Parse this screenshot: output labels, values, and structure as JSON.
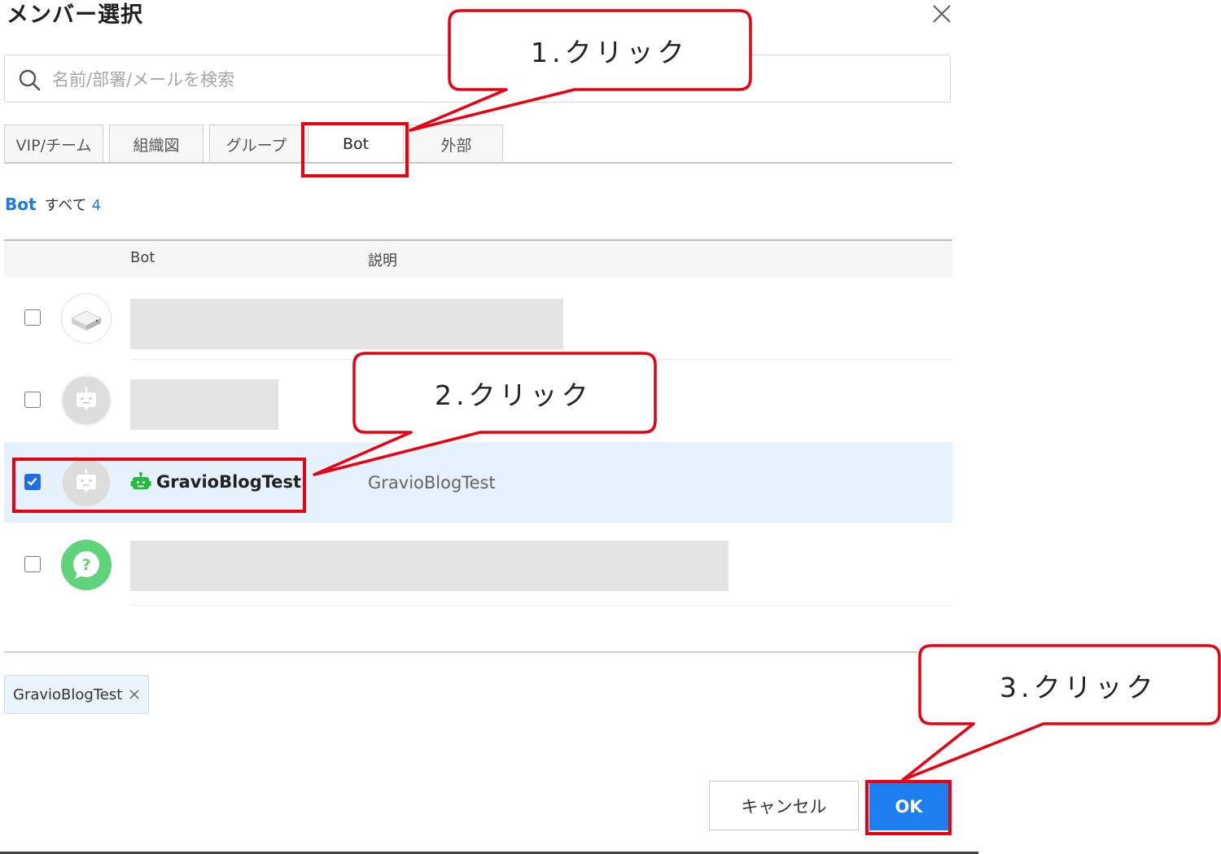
{
  "dialog": {
    "title": "メンバー選択",
    "search_placeholder": "名前/部署/メールを検索"
  },
  "tabs": [
    {
      "label": "VIP/チーム"
    },
    {
      "label": "組織図"
    },
    {
      "label": "グループ"
    },
    {
      "label": "Bot",
      "active": true
    },
    {
      "label": "外部"
    }
  ],
  "count": {
    "category": "Bot",
    "all_label": "すべて",
    "total": "4"
  },
  "table": {
    "columns": [
      "Bot",
      "説明"
    ],
    "rows": [
      {
        "checked": false,
        "name": "",
        "description": "",
        "redacted": true,
        "icon": "device-icon"
      },
      {
        "checked": false,
        "name": "",
        "description": "",
        "redacted": true,
        "icon": "robot-icon"
      },
      {
        "checked": true,
        "name": "GravioBlogTest",
        "description": "GravioBlogTest",
        "redacted": false,
        "icon": "robot-icon"
      },
      {
        "checked": false,
        "name": "",
        "description": "",
        "redacted": true,
        "icon": "question-chat-icon"
      }
    ]
  },
  "selected_chip": {
    "label": "GravioBlogTest"
  },
  "buttons": {
    "cancel": "キャンセル",
    "ok": "OK"
  },
  "annotations": {
    "step1": "1.クリック",
    "step2": "2.クリック",
    "step3": "3.クリック",
    "highlight_color": "#e60012"
  },
  "colors": {
    "accent": "#1d7ef0",
    "selected_row": "#e5f1fd",
    "bot_icon_green": "#1fbf3c"
  }
}
